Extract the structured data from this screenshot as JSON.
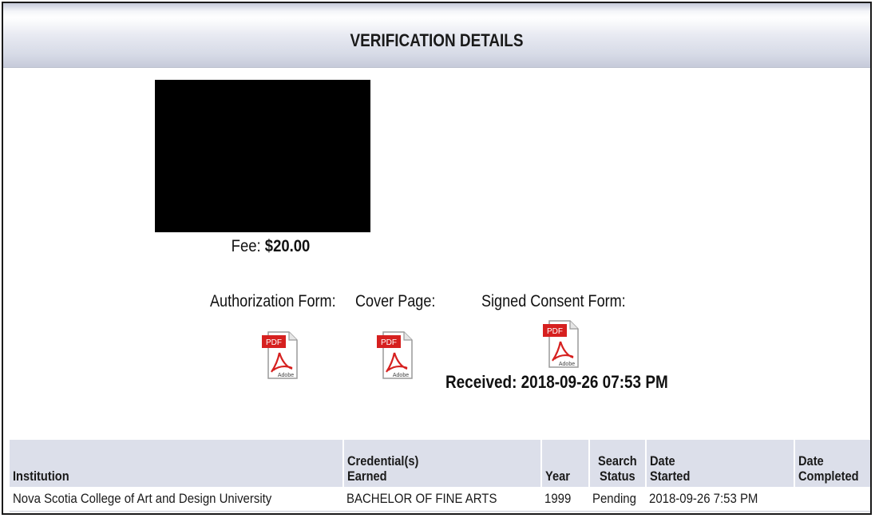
{
  "header": {
    "title": "VERIFICATION DETAILS"
  },
  "fee": {
    "label": "Fee:",
    "value": "$20.00"
  },
  "documents": {
    "authorization_label": "Authorization Form:",
    "cover_label": "Cover Page:",
    "consent_label": "Signed Consent Form:",
    "received": "Received: 2018-09-26 07:53 PM",
    "icon_text_top": "PDF",
    "icon_text_bottom": "Adobe"
  },
  "table": {
    "headers": {
      "institution": "Institution",
      "credential_line1": "Credential(s)",
      "credential_line2": "Earned",
      "year": "Year",
      "status_line1": "Search",
      "status_line2": "Status",
      "started_line1": "Date",
      "started_line2": "Started",
      "completed_line1": "Date",
      "completed_line2": "Completed"
    },
    "rows": [
      {
        "institution": "Nova Scotia College of Art and Design University",
        "credential": "BACHELOR OF FINE ARTS",
        "year": "1999",
        "status": "Pending",
        "date_started": "2018-09-26 7:53 PM",
        "date_completed": ""
      }
    ]
  },
  "colors": {
    "header_band": "#dcdfea",
    "pdf_red": "#d6201f",
    "redaction": "#000000"
  }
}
